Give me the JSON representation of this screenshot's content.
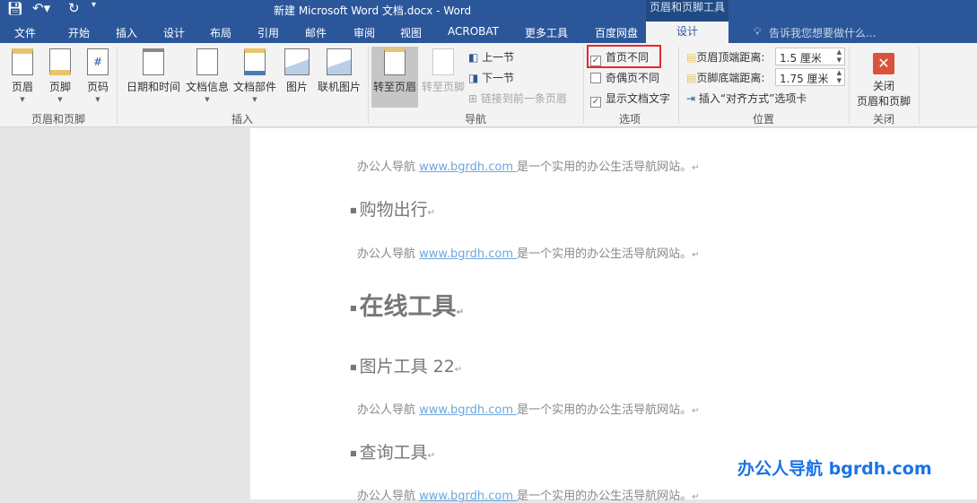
{
  "window": {
    "title": "新建 Microsoft Word 文档.docx - Word",
    "context_tab_group": "页眉和页脚工具"
  },
  "quick_access": {
    "save": "save-icon",
    "undo": "undo-icon",
    "redo": "repeat-icon",
    "customize": "customize-icon"
  },
  "tabs": [
    "文件",
    "开始",
    "插入",
    "设计",
    "布局",
    "引用",
    "邮件",
    "审阅",
    "视图",
    "ACROBAT",
    "更多工具",
    "百度网盘",
    "设计"
  ],
  "tell_me": "告诉我您想要做什么...",
  "ribbon": {
    "groups": {
      "hf": "页眉和页脚",
      "insert": "插入",
      "nav": "导航",
      "options": "选项",
      "position": "位置",
      "close": "关闭"
    },
    "hf": [
      "页眉",
      "页脚",
      "页码"
    ],
    "insert": [
      "日期和时间",
      "文档信息",
      "文档部件",
      "图片",
      "联机图片"
    ],
    "nav": {
      "goto_header": "转至页眉",
      "goto_footer": "转至页脚",
      "prev": "上一节",
      "next": "下一节",
      "link": "链接到前一条页眉"
    },
    "options": [
      {
        "label": "首页不同",
        "checked": true
      },
      {
        "label": "奇偶页不同",
        "checked": false
      },
      {
        "label": "显示文档文字",
        "checked": true
      }
    ],
    "position": {
      "header_label": "页眉顶端距离:",
      "header_value": "1.5 厘米",
      "footer_label": "页脚底端距离:",
      "footer_value": "1.75 厘米",
      "align_tab": "插入“对齐方式”选项卡"
    },
    "close": {
      "line1": "关闭",
      "line2": "页眉和页脚"
    }
  },
  "document": {
    "para_prefix": "办公人导航 ",
    "link": "www.bgrdh.com ",
    "para_suffix": "是一个实用的办公生活导航网站。",
    "headings": [
      "购物出行",
      "在线工具",
      "图片工具 22",
      "查询工具"
    ],
    "mark": "↵"
  },
  "watermark": "办公人导航  bgrdh.com",
  "colors": {
    "accent": "#2b579a",
    "highlight_box": "#e8282e",
    "close_icon": "#d9533c"
  }
}
